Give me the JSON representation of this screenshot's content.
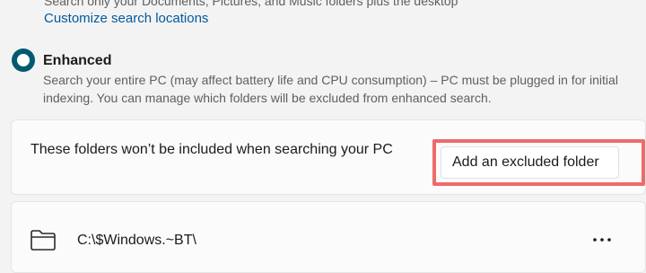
{
  "classic": {
    "description": "Search only your Documents, Pictures, and Music folders plus the desktop",
    "customize_link": "Customize search locations"
  },
  "enhanced": {
    "title": "Enhanced",
    "description": "Search your entire PC (may affect battery life and CPU consumption) – PC must be plugged in for initial indexing. You can manage which folders will be excluded from enhanced search.",
    "selected": true
  },
  "excluded": {
    "header_text": "These folders won’t be included when searching your PC",
    "add_button_label": "Add an excluded folder",
    "folders": [
      {
        "path": "C:\\$Windows.~BT\\",
        "icon": "folder-icon"
      }
    ]
  },
  "colors": {
    "accent": "#005a70",
    "link": "#005a9e",
    "highlight": "#ef6b6b"
  }
}
